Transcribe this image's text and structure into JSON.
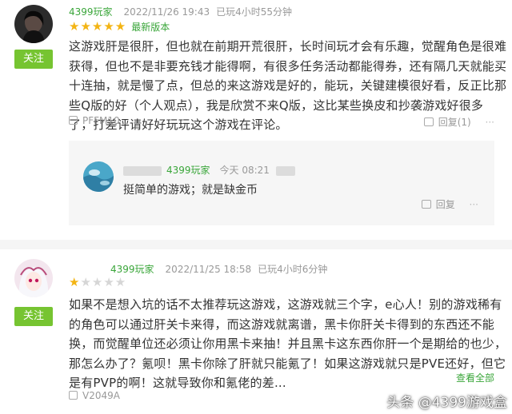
{
  "review1": {
    "username_hidden": true,
    "user": "4399玩家",
    "timestamp": "2022/11/26 19:43",
    "playtime": "已玩4小时55分钟",
    "stars": 5,
    "badge": "最新版本",
    "follow_label": "关注",
    "text": "这游戏肝是很肝，但也就在前期开荒很肝，长时间玩才会有乐趣，觉醒角色是很难获得，但也不是非要充钱才能得啊，有很多任务活动都能得券，还有隔几天就能买十连抽，就是慢了点，但总的来这游戏是好的，能玩，关键建模很好看，反正比那些Q版的好（个人观点），我是欣赏不来Q版，这比某些换皮和抄袭游戏好很多了，打差评请好好玩玩这个游戏在评论。",
    "device": "PFFM10",
    "reply_label": "回复(1)",
    "like_label": "",
    "reply": {
      "user": "4399玩家",
      "time": "今天 08:21",
      "text": "挺简单的游戏；就是缺金币",
      "reply_label": "回复"
    }
  },
  "review2": {
    "user": "4399玩家",
    "timestamp": "2022/11/25 18:58",
    "playtime": "已玩4小时6分钟",
    "stars": 1,
    "follow_label": "关注",
    "text": "如果不是想入坑的话不太推荐玩这游戏，这游戏就三个字，e心人！别的游戏稀有的角色可以通过肝关卡来得，而这游戏就离谱，黑卡你肝关卡得到的东西还不能换，而觉醒单位还必须让你用黑卡来抽！并且黑卡这东西你肝一个是期给的也少，那怎么办了？氪呗！黑卡你除了肝就只能氪了！如果这游戏就只是PVE还好，但它是有PVP的啊！这就导致你和氪佬的差...",
    "more_label": "查看全部",
    "device": "V2049A"
  },
  "watermark": "头条 @4399游戏盒",
  "colors": {
    "accent": "#76c431",
    "user_green": "#3aa63a",
    "star": "#f3b413"
  }
}
